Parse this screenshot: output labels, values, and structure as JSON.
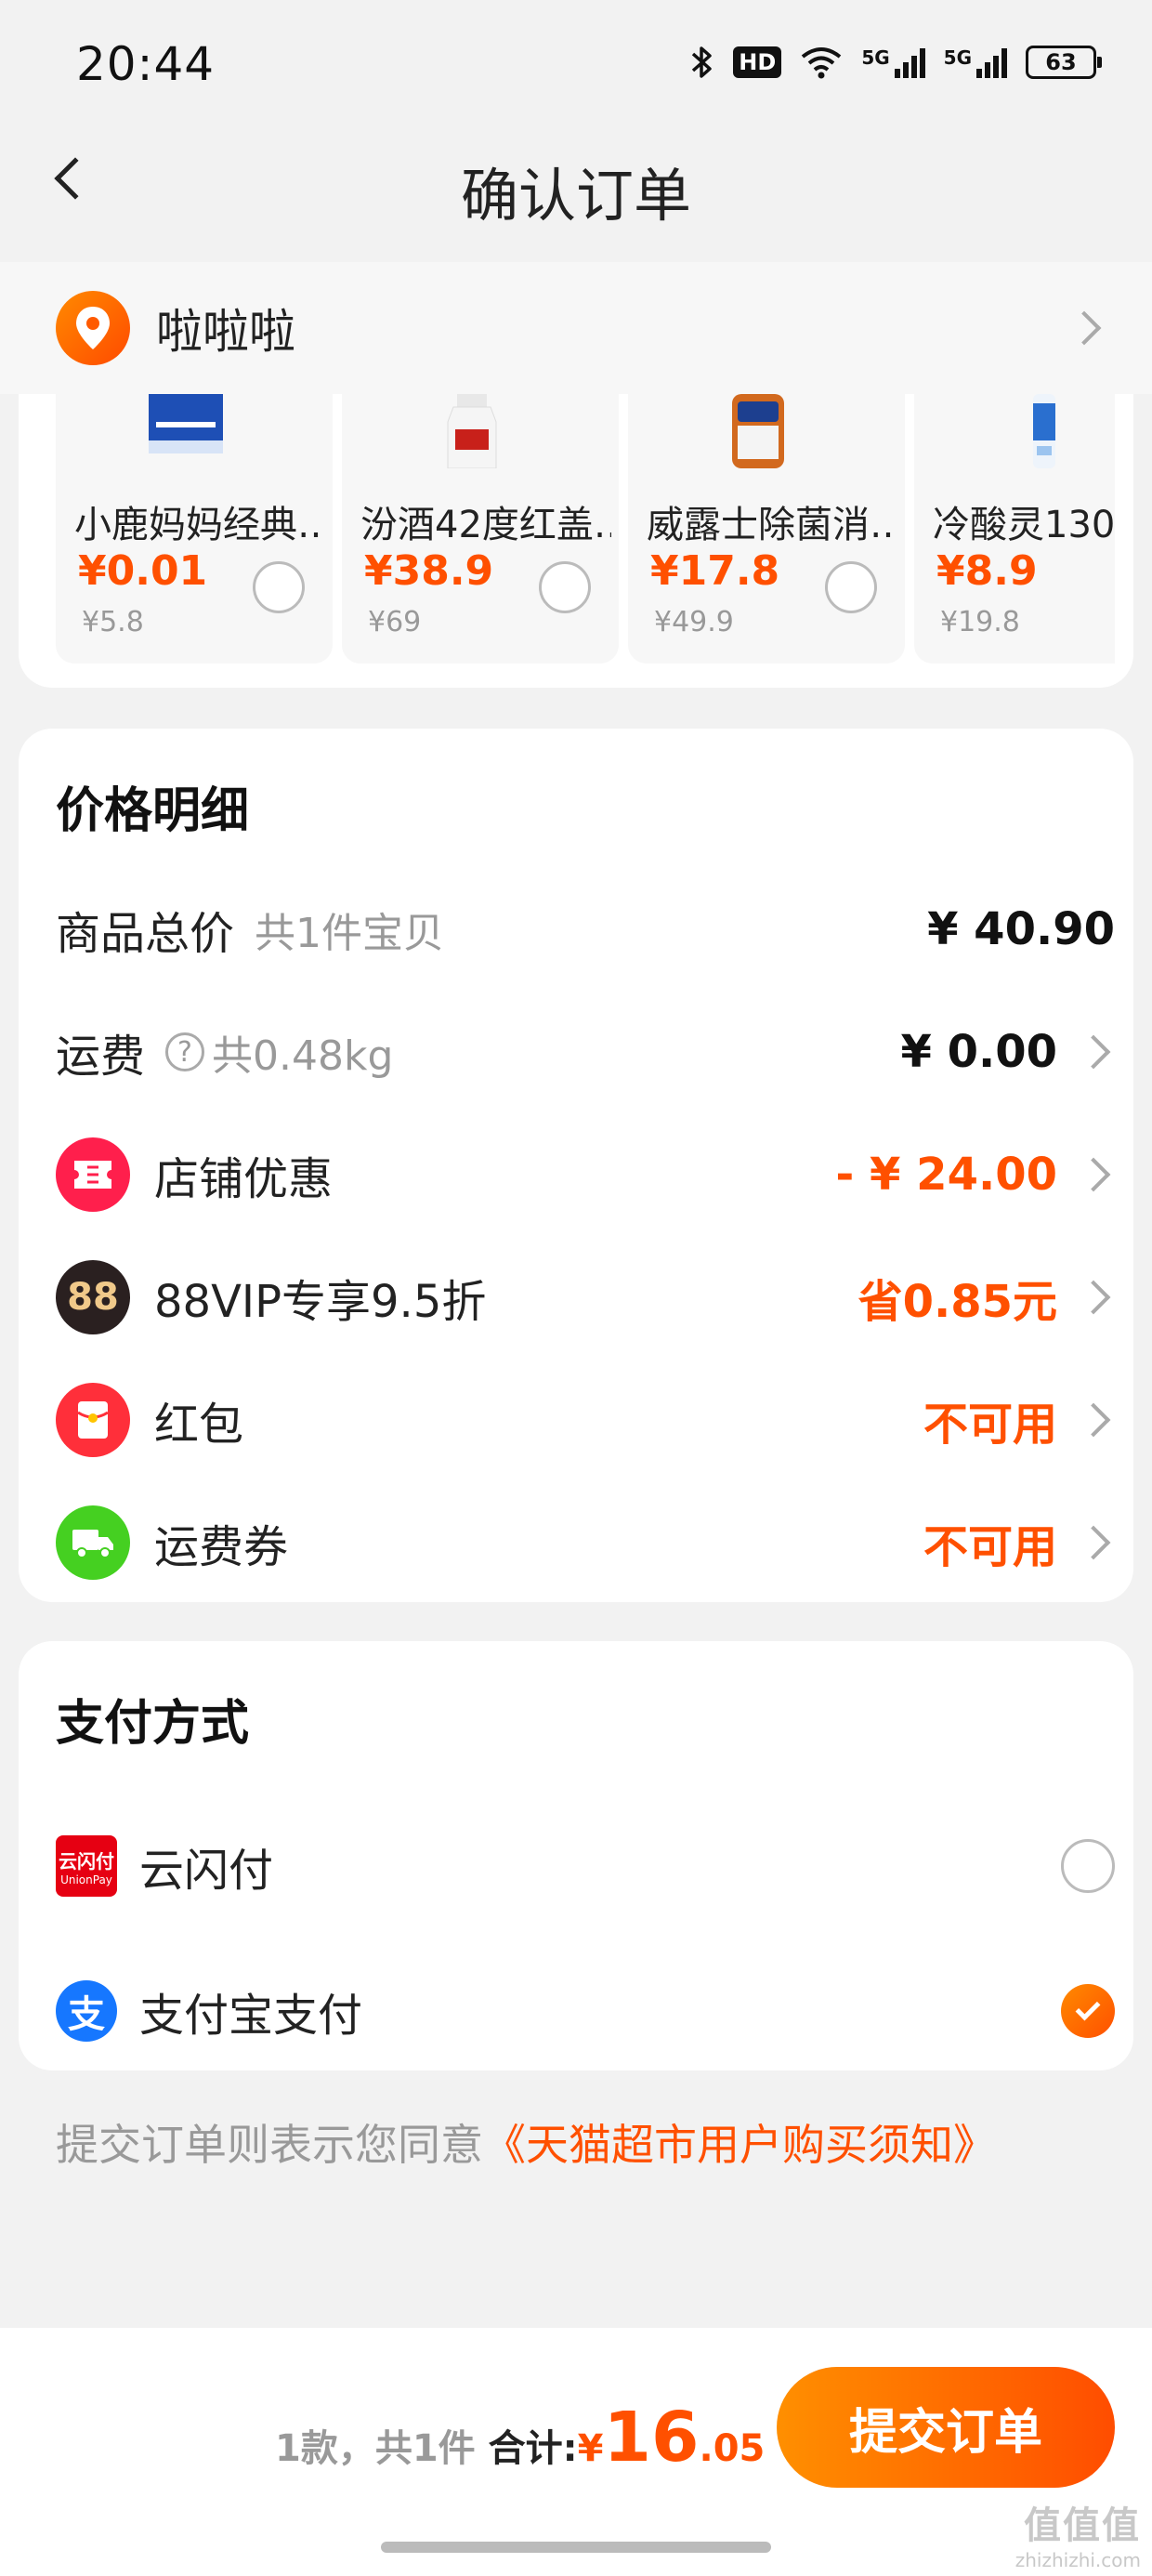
{
  "status_bar": {
    "time": "20:44",
    "bluetooth_icon": "bluetooth-icon",
    "hd_badge": "HD",
    "wifi_icon": "wifi-icon",
    "signal_1": "5G",
    "signal_2": "5G",
    "battery": "63"
  },
  "nav": {
    "back_icon": "chevron-left-icon",
    "title": "确认订单"
  },
  "address": {
    "icon": "location-pin-icon",
    "text": "啦啦啦",
    "chevron_icon": "chevron-right-icon"
  },
  "recommendations": [
    {
      "name": "小鹿妈妈经典…",
      "price": "¥0.01",
      "original": "¥5.8",
      "checked": false
    },
    {
      "name": "汾酒42度红盖…",
      "price": "¥38.9",
      "original": "¥69",
      "checked": false
    },
    {
      "name": "威露士除菌消…",
      "price": "¥17.8",
      "original": "¥49.9",
      "checked": false
    },
    {
      "name": "冷酸灵130",
      "price": "¥8.9",
      "original": "¥19.8",
      "checked": false
    }
  ],
  "price_detail": {
    "title": "价格明细",
    "total": {
      "label": "商品总价",
      "sub": "共1件宝贝",
      "value": "¥ 40.90"
    },
    "shipping": {
      "label": "运费",
      "help": "?",
      "sub": "共0.48kg",
      "value": "¥ 0.00"
    },
    "store_discount": {
      "label": "店铺优惠",
      "value": "- ¥ 24.00",
      "icon": "ticket-icon"
    },
    "vip": {
      "label": "88VIP专享9.5折",
      "value": "省0.85元",
      "icon": "88vip-icon",
      "icon_text": "88"
    },
    "red_packet": {
      "label": "红包",
      "value": "不可用",
      "icon": "red-packet-icon"
    },
    "shipping_coupon": {
      "label": "运费券",
      "value": "不可用",
      "icon": "truck-icon"
    }
  },
  "payment": {
    "title": "支付方式",
    "methods": [
      {
        "label": "云闪付",
        "icon": "unionpay-icon",
        "icon_text": "云闪付",
        "icon_sub": "UnionPay",
        "selected": false
      },
      {
        "label": "支付宝支付",
        "icon": "alipay-icon",
        "icon_text": "支",
        "selected": true
      }
    ]
  },
  "agreement": {
    "prefix": "提交订单则表示您同意",
    "link": "《天猫超市用户购买须知》"
  },
  "footer": {
    "count": "1款，共1件",
    "total_label": "合计:",
    "currency": "¥",
    "total_int": "16",
    "total_dec": ".05",
    "submit_label": "提交订单",
    "watermark": "值值值",
    "watermark_url": "zhizhizhi.com"
  },
  "colors": {
    "accent": "#ff5000",
    "background": "#f2f2f2"
  }
}
